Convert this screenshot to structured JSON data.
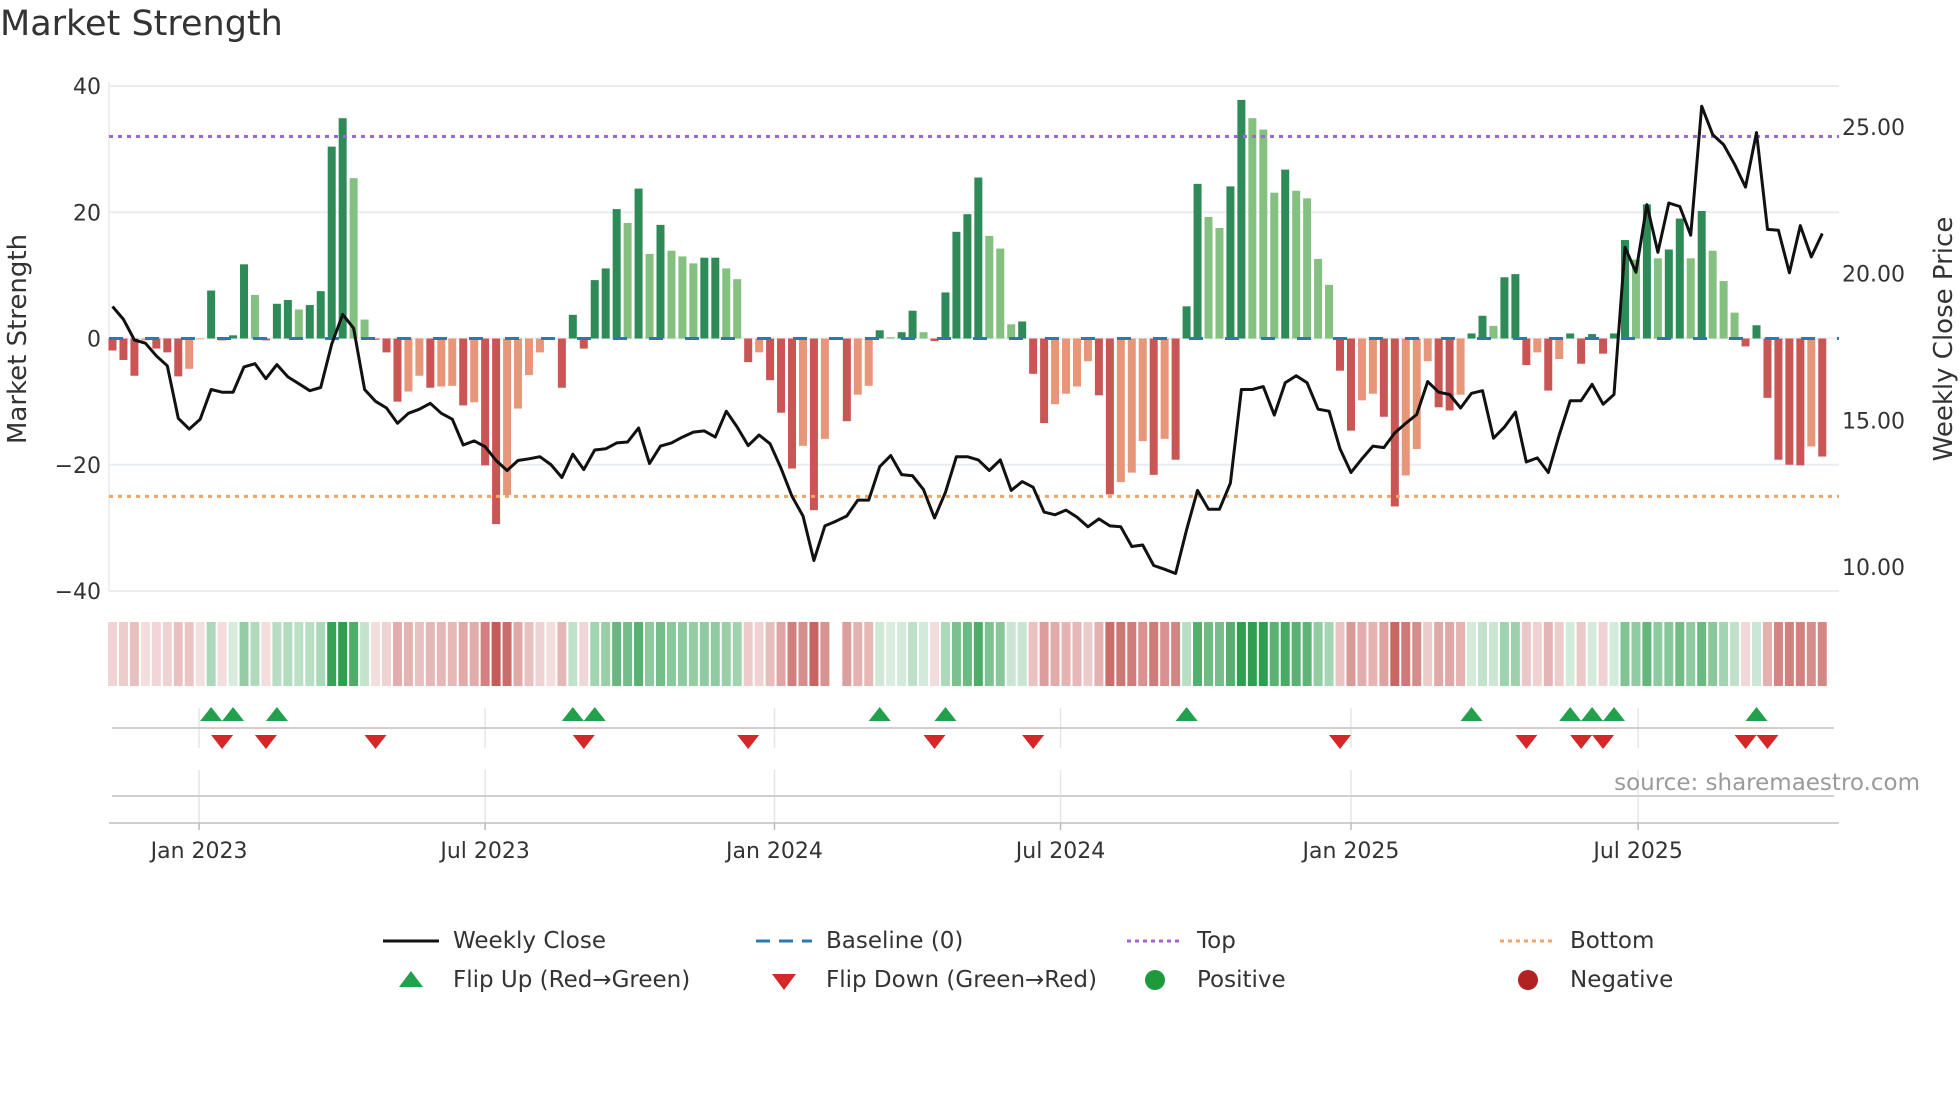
{
  "title": "Market Strength",
  "source": "source: sharemaestro.com",
  "legend": {
    "weekly_close": "Weekly Close",
    "baseline": "Baseline (0)",
    "top": "Top",
    "bottom": "Bottom",
    "flip_up": "Flip Up (Red→Green)",
    "flip_down": "Flip Down (Green→Red)",
    "positive": "Positive",
    "negative": "Negative"
  },
  "colors": {
    "dark_green": "#2e8b57",
    "light_green": "#84c07f",
    "dark_red": "#c95555",
    "light_red": "#e8967a",
    "heat_green": "#2f9e4f",
    "heat_red": "#c0504d",
    "baseline": "#2a7ab0",
    "top": "#a066d3",
    "bottom": "#f4a460",
    "price": "#111111",
    "flip_up": "#22a04b",
    "flip_down": "#d62728",
    "positive": "#1e9a3c",
    "negative": "#b22222"
  },
  "chart_data": {
    "type": "bar+line",
    "title": "Market Strength",
    "ylabel": "Market Strength",
    "y2label": "Weekly Close Price",
    "ylim": [
      -40,
      40
    ],
    "y2lim": [
      10,
      25
    ],
    "yticks": [
      40,
      20,
      0,
      -20,
      -40
    ],
    "ytick_labels": [
      "40",
      "20",
      "0",
      "−20",
      "−40"
    ],
    "y2ticks": [
      25,
      20,
      15,
      10
    ],
    "y2tick_labels": [
      "25.00",
      "20.00",
      "15.00",
      "10.00"
    ],
    "x_unit": "week index",
    "xticks": [
      {
        "label": "Jan 2023",
        "week": 7.9
      },
      {
        "label": "Jul 2023",
        "week": 34.0
      },
      {
        "label": "Jan 2024",
        "week": 60.4
      },
      {
        "label": "Jul 2024",
        "week": 86.5
      },
      {
        "label": "Jan 2025",
        "week": 113.0
      },
      {
        "label": "Jul 2025",
        "week": 139.2
      }
    ],
    "top_level": 32,
    "bottom_level": -25,
    "baseline": 0,
    "strength": [
      -1.9,
      -3.4,
      -5.9,
      -0.3,
      -1.6,
      -2.2,
      -6,
      -4.8,
      -0.1,
      7.6,
      -0.3,
      0.5,
      11.75,
      6.9,
      -0.3,
      5.5,
      6.1,
      4.6,
      5.3,
      7.5,
      30.4,
      34.9,
      25.4,
      3,
      -0.2,
      -2.2,
      -10,
      -8.4,
      -5.9,
      -7.8,
      -7.6,
      -7.5,
      -10.6,
      -10.1,
      -20.1,
      -29.4,
      -24.8,
      -11.1,
      -5.8,
      -2.2,
      -0.2,
      -7.8,
      3.75,
      -1.6,
      9.25,
      11.1,
      20.5,
      18.3,
      23.75,
      13.4,
      18,
      13.9,
      13,
      11.9,
      12.8,
      12.8,
      11.1,
      9.4,
      -3.75,
      -2.2,
      -6.6,
      -11.75,
      -20.6,
      -17,
      -27.2,
      -15.9,
      0,
      -13.1,
      -8.9,
      -7.5,
      1.3,
      0.2,
      1,
      4.4,
      1,
      -0.4,
      7.3,
      16.9,
      19.7,
      25.5,
      16.25,
      14.25,
      2.25,
      2.7,
      -5.6,
      -13.4,
      -10.4,
      -8.75,
      -7.6,
      -3.6,
      -9,
      -24.7,
      -22.75,
      -21.25,
      -16.25,
      -21.6,
      -15.9,
      -19.2,
      5.1,
      24.5,
      19.25,
      17.5,
      24.1,
      37.8,
      34.9,
      33.1,
      23.1,
      26.75,
      23.4,
      22.2,
      12.6,
      8.5,
      -5.1,
      -14.6,
      -9.8,
      -8.75,
      -12.4,
      -26.6,
      -21.7,
      -17.5,
      -3.6,
      -10.9,
      -11.4,
      -8.9,
      0.8,
      3.6,
      2,
      9.7,
      10.2,
      -4.2,
      -2.2,
      -8.25,
      -3.25,
      0.8,
      -4,
      0.7,
      -2.4,
      0.8,
      15.6,
      12.5,
      21.25,
      12.7,
      14.1,
      19,
      12.7,
      20.2,
      13.9,
      9.1,
      4.1,
      -1.25,
      2.1,
      -9.4,
      -19.2,
      -20,
      -20.1,
      -17.1,
      -18.7
    ],
    "weekly_close": [
      18.88,
      18.44,
      17.74,
      17.63,
      17.2,
      16.86,
      15.07,
      14.7,
      15.04,
      16.05,
      15.96,
      15.96,
      16.82,
      16.93,
      16.42,
      16.9,
      16.48,
      16.25,
      16.01,
      16.12,
      17.6,
      18.61,
      18.14,
      16.05,
      15.65,
      15.42,
      14.9,
      15.24,
      15.38,
      15.58,
      15.24,
      15.04,
      14.16,
      14.3,
      14.1,
      13.63,
      13.29,
      13.63,
      13.69,
      13.76,
      13.49,
      13.05,
      13.85,
      13.32,
      13.99,
      14.03,
      14.23,
      14.26,
      14.74,
      13.53,
      14.12,
      14.23,
      14.43,
      14.6,
      14.64,
      14.43,
      15.31,
      14.77,
      14.14,
      14.5,
      14.2,
      13.36,
      12.41,
      11.74,
      10.22,
      11.4,
      11.56,
      11.74,
      12.28,
      12.28,
      13.42,
      13.8,
      13.15,
      13.11,
      12.64,
      11.67,
      12.55,
      13.76,
      13.76,
      13.65,
      13.29,
      13.65,
      12.61,
      12.91,
      12.72,
      11.87,
      11.78,
      11.94,
      11.7,
      11.37,
      11.64,
      11.4,
      11.37,
      10.7,
      10.75,
      10.05,
      9.92,
      9.78,
      11.27,
      12.61,
      11.97,
      11.97,
      12.86,
      16.05,
      16.05,
      16.15,
      15.18,
      16.28,
      16.52,
      16.28,
      15.38,
      15.31,
      14.03,
      13.22,
      13.69,
      14.12,
      14.07,
      14.57,
      14.9,
      15.2,
      16.32,
      15.96,
      15.88,
      15.42,
      15.92,
      16.01,
      14.39,
      14.77,
      15.28,
      13.58,
      13.72,
      13.22,
      14.5,
      15.67,
      15.67,
      16.23,
      15.55,
      15.88,
      20.9,
      20.05,
      22.35,
      20.73,
      22.41,
      22.29,
      21.31,
      25.71,
      24.74,
      24.4,
      23.73,
      22.95,
      24.81,
      21.51,
      21.48,
      20.03,
      21.64,
      20.57,
      21.37
    ],
    "flip_up_weeks": [
      10,
      12,
      16,
      43,
      45,
      71,
      77,
      99,
      125,
      134,
      136,
      138,
      151
    ],
    "flip_down_weeks": [
      11,
      15,
      25,
      44,
      59,
      76,
      85,
      113,
      130,
      135,
      137,
      150,
      152
    ],
    "grid": true,
    "legend_position": "bottom"
  }
}
